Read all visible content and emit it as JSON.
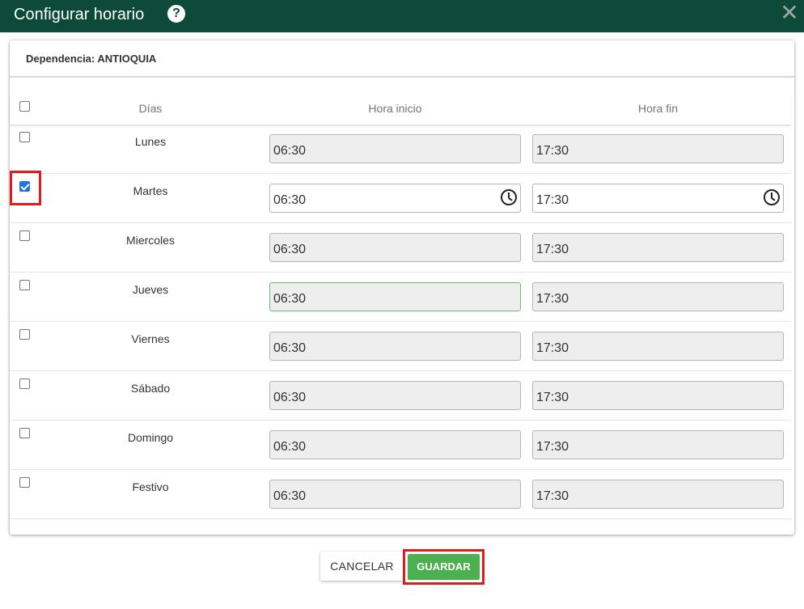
{
  "dialog": {
    "title": "Configurar horario",
    "help_icon": "question-circle-icon",
    "close_icon": "close-icon",
    "close_glyph": "✕",
    "help_glyph": "?"
  },
  "header": {
    "dependencia": "Dependencia: ANTIOQUIA"
  },
  "table": {
    "columns": {
      "dias": "Días",
      "hora_inicio": "Hora inicio",
      "hora_fin": "Hora fin"
    },
    "rows": [
      {
        "day": "Lunes",
        "checked": false,
        "start": "06:30",
        "end": "17:30"
      },
      {
        "day": "Martes",
        "checked": true,
        "start": "06:30",
        "end": "17:30"
      },
      {
        "day": "Miercoles",
        "checked": false,
        "start": "06:30",
        "end": "17:30"
      },
      {
        "day": "Jueves",
        "checked": false,
        "start": "06:30",
        "end": "17:30"
      },
      {
        "day": "Viernes",
        "checked": false,
        "start": "06:30",
        "end": "17:30"
      },
      {
        "day": "Sábado",
        "checked": false,
        "start": "06:30",
        "end": "17:30"
      },
      {
        "day": "Domingo",
        "checked": false,
        "start": "06:30",
        "end": "17:30"
      },
      {
        "day": "Festivo",
        "checked": false,
        "start": "06:30",
        "end": "17:30"
      }
    ]
  },
  "buttons": {
    "cancel": "CANCELAR",
    "save": "GUARDAR"
  },
  "colors": {
    "titlebar": "#0d4a3a",
    "save": "#4caf50",
    "highlight": "#e01b1b"
  }
}
